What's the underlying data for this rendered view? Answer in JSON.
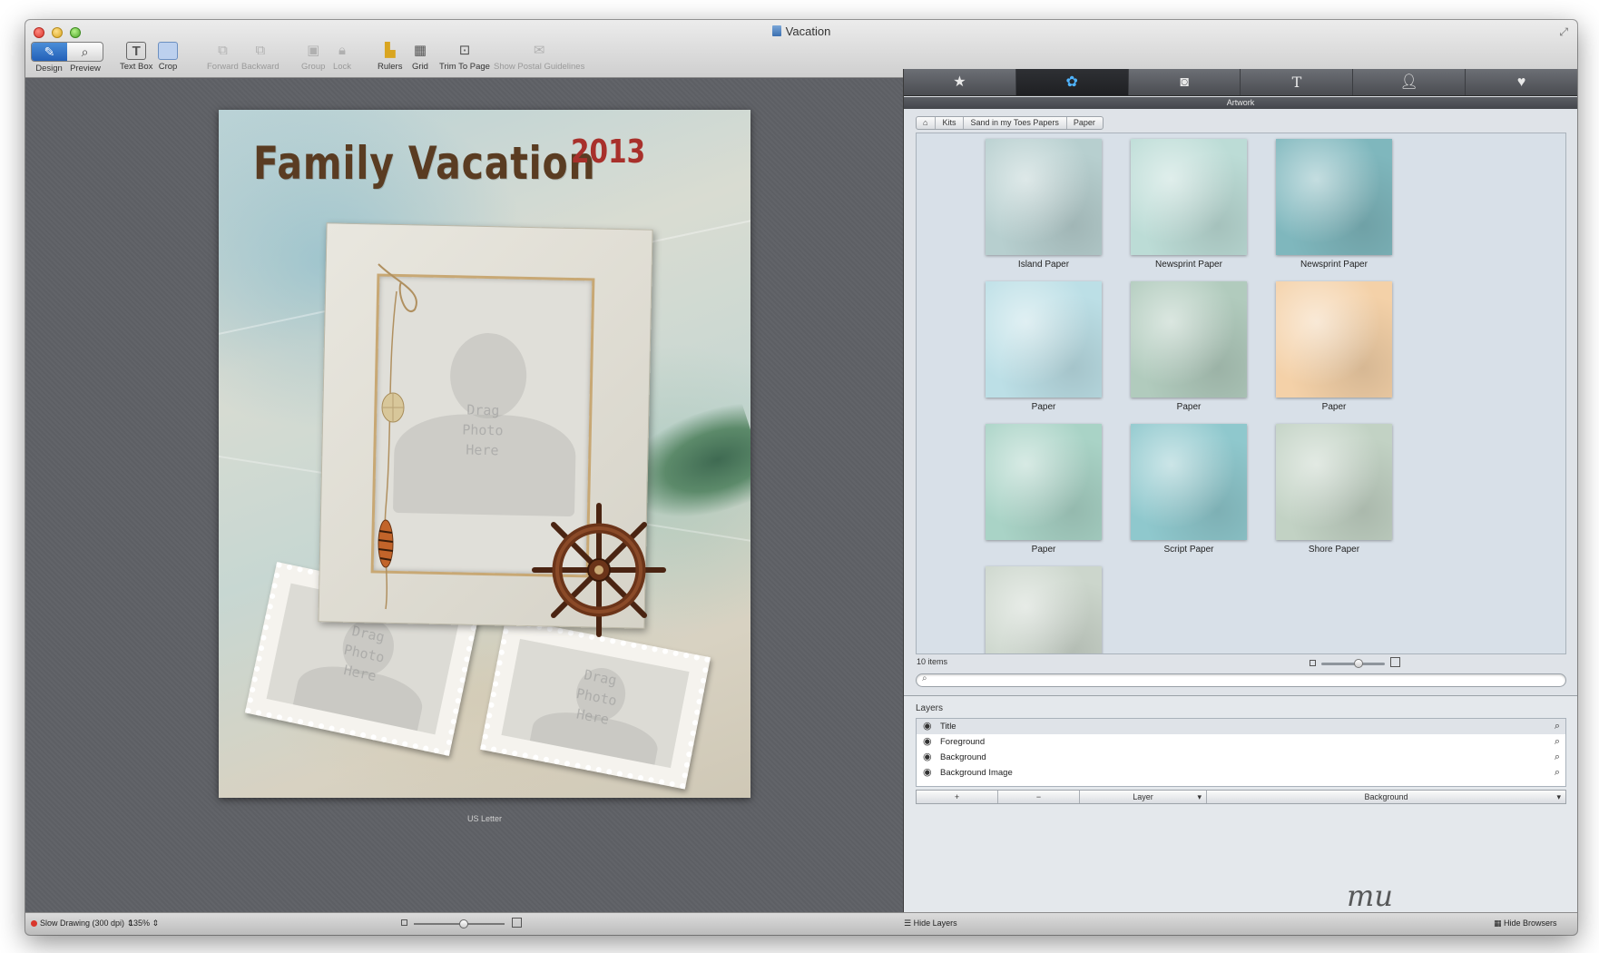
{
  "window": {
    "title": "Vacation"
  },
  "toolbar": {
    "mode_design": "Design",
    "mode_preview": "Preview",
    "text_box": "Text Box",
    "crop": "Crop",
    "forward": "Forward",
    "backward": "Backward",
    "group": "Group",
    "lock": "Lock",
    "rulers": "Rulers",
    "grid": "Grid",
    "trim_to_page": "Trim To Page",
    "show_postal_guidelines": "Show Postal Guidelines"
  },
  "canvas": {
    "title": "Family Vacation",
    "year": "2013",
    "drop_hint": [
      "Drag",
      "Photo",
      "Here"
    ],
    "page_size": "US Letter"
  },
  "panel": {
    "tabs": [
      "star-icon",
      "artwork-icon",
      "camera-icon",
      "text-icon",
      "person-icon",
      "heart-icon"
    ],
    "section": "Artwork",
    "breadcrumb": [
      "Kits",
      "Sand in my Toes Papers",
      "Paper"
    ],
    "items": [
      {
        "name": "Island Paper",
        "color": "#b7cfcf"
      },
      {
        "name": "Newsprint Paper",
        "color": "#bcdcd6"
      },
      {
        "name": "Newsprint Paper",
        "color": "#7fb7bd"
      },
      {
        "name": "Paper",
        "color": "#bcdfe6"
      },
      {
        "name": "Paper",
        "color": "#b1cbbd"
      },
      {
        "name": "Paper",
        "color": "#f4d1a8"
      },
      {
        "name": "Paper",
        "color": "#a9d3c6"
      },
      {
        "name": "Script Paper",
        "color": "#8fc8cd"
      },
      {
        "name": "Shore Paper",
        "color": "#c2d2c4"
      },
      {
        "name": "",
        "color": "#ccd6cc"
      }
    ],
    "items_count": "10 items",
    "search_value": "",
    "thumb_size": 0.6
  },
  "layers": {
    "title": "Layers",
    "rows": [
      "Title",
      "Foreground",
      "Background",
      "Background Image"
    ],
    "add": "+",
    "remove": "−",
    "layer_menu": "Layer",
    "background_menu": "Background"
  },
  "statusbar": {
    "drawing_mode": "Slow Drawing (300 dpi)",
    "zoom": "135%",
    "zoom_fraction": 0.55,
    "hide_layers": "Hide Layers",
    "hide_browsers": "Hide Browsers"
  },
  "watermark": "mu"
}
